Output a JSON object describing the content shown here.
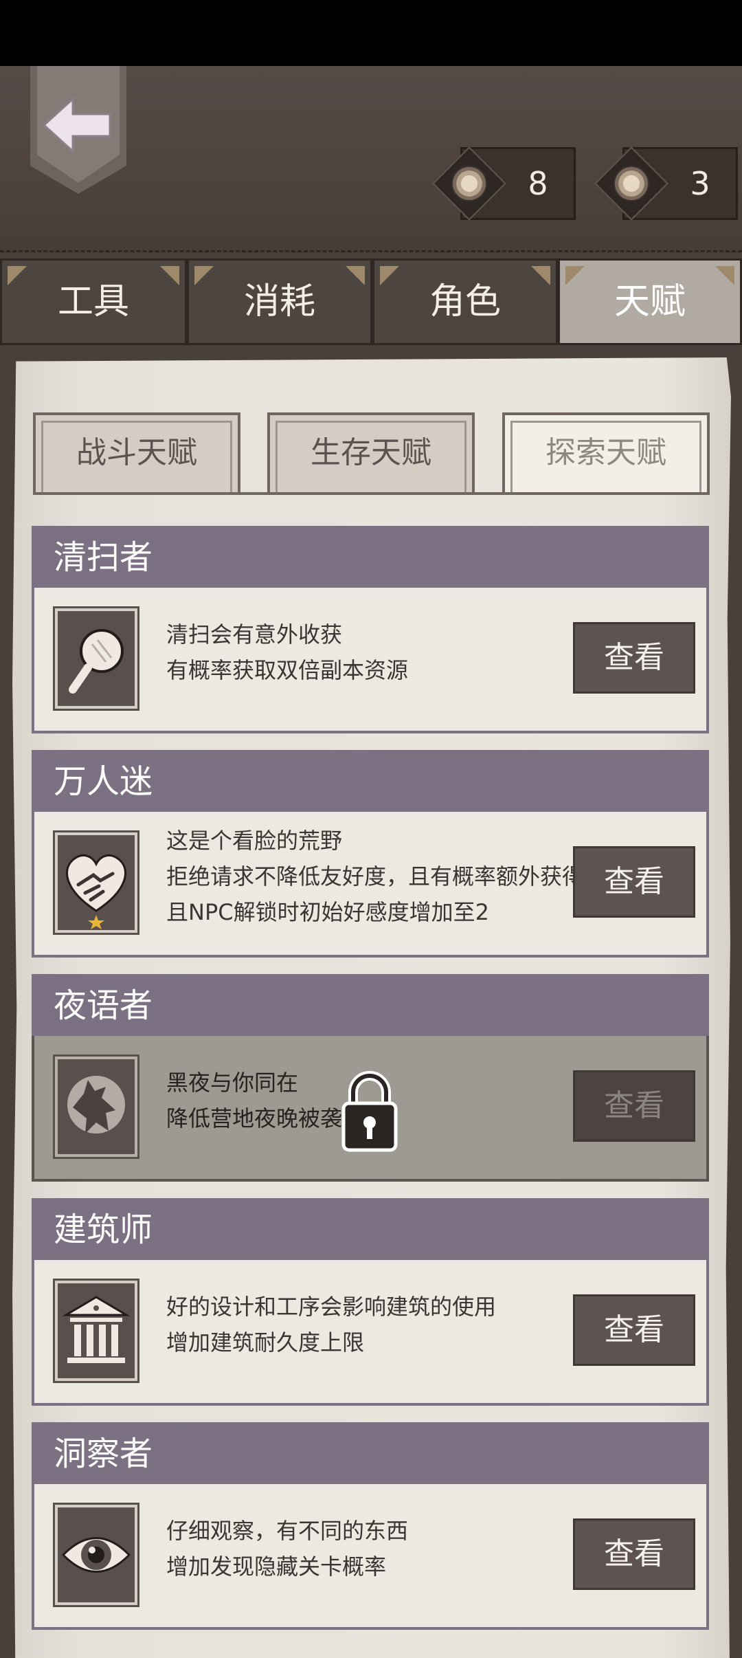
{
  "header": {
    "counters": [
      {
        "icon": "coin-icon",
        "value": "8"
      },
      {
        "icon": "coin-icon",
        "value": "3"
      }
    ]
  },
  "main_tabs": [
    {
      "label": "工具",
      "active": false
    },
    {
      "label": "消耗",
      "active": false
    },
    {
      "label": "角色",
      "active": false
    },
    {
      "label": "天赋",
      "active": true
    }
  ],
  "sub_tabs": [
    {
      "label": "战斗天赋",
      "active": false
    },
    {
      "label": "生存天赋",
      "active": false
    },
    {
      "label": "探索天赋",
      "active": true
    }
  ],
  "talents": [
    {
      "name": "清扫者",
      "icon": "magnifier-icon",
      "lines": [
        "清扫会有意外收获",
        "有概率获取双倍副本资源"
      ],
      "button": "查看",
      "locked": false
    },
    {
      "name": "万人迷",
      "icon": "heart-handshake-icon",
      "lines": [
        "这是个看脸的荒野",
        "拒绝请求不降低友好度，且有概率额外获得物",
        "且NPC解锁时初始好感度增加至2"
      ],
      "button": "查看",
      "locked": false
    },
    {
      "name": "夜语者",
      "icon": "wolf-moon-icon",
      "lines": [
        "黑夜与你同在",
        "降低营地夜晚被袭击"
      ],
      "button": "查看",
      "locked": true
    },
    {
      "name": "建筑师",
      "icon": "building-icon",
      "lines": [
        "好的设计和工序会影响建筑的使用",
        "增加建筑耐久度上限"
      ],
      "button": "查看",
      "locked": false
    },
    {
      "name": "洞察者",
      "icon": "eye-icon",
      "lines": [
        "仔细观察，有不同的东西",
        "增加发现隐藏关卡概率"
      ],
      "button": "查看",
      "locked": false
    }
  ],
  "colors": {
    "card_header": "#7b7182",
    "button": "#5d5351",
    "paper": "#e9e5de",
    "leather": "#4c423d"
  }
}
